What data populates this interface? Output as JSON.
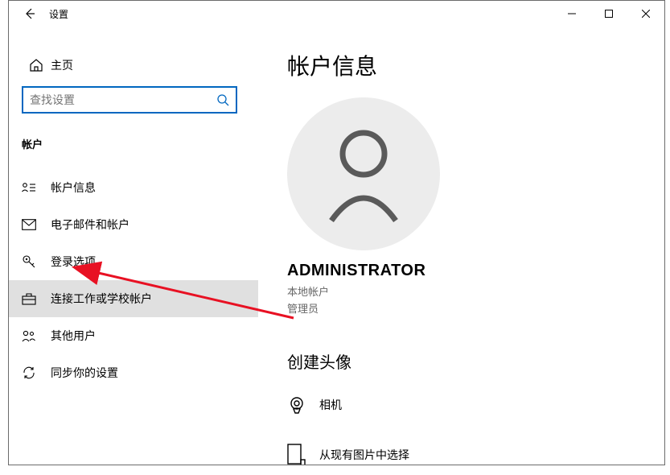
{
  "window": {
    "title": "设置"
  },
  "sidebar": {
    "home_label": "主页",
    "search_placeholder": "查找设置",
    "category_label": "帐户",
    "items": [
      {
        "label": "帐户信息"
      },
      {
        "label": "电子邮件和帐户"
      },
      {
        "label": "登录选项"
      },
      {
        "label": "连接工作或学校帐户"
      },
      {
        "label": "其他用户"
      },
      {
        "label": "同步你的设置"
      }
    ]
  },
  "main": {
    "page_title": "帐户信息",
    "username": "ADMINISTRATOR",
    "account_type": "本地帐户",
    "account_role": "管理员",
    "create_avatar_title": "创建头像",
    "options": [
      {
        "label": "相机"
      },
      {
        "label": "从现有图片中选择"
      }
    ]
  }
}
